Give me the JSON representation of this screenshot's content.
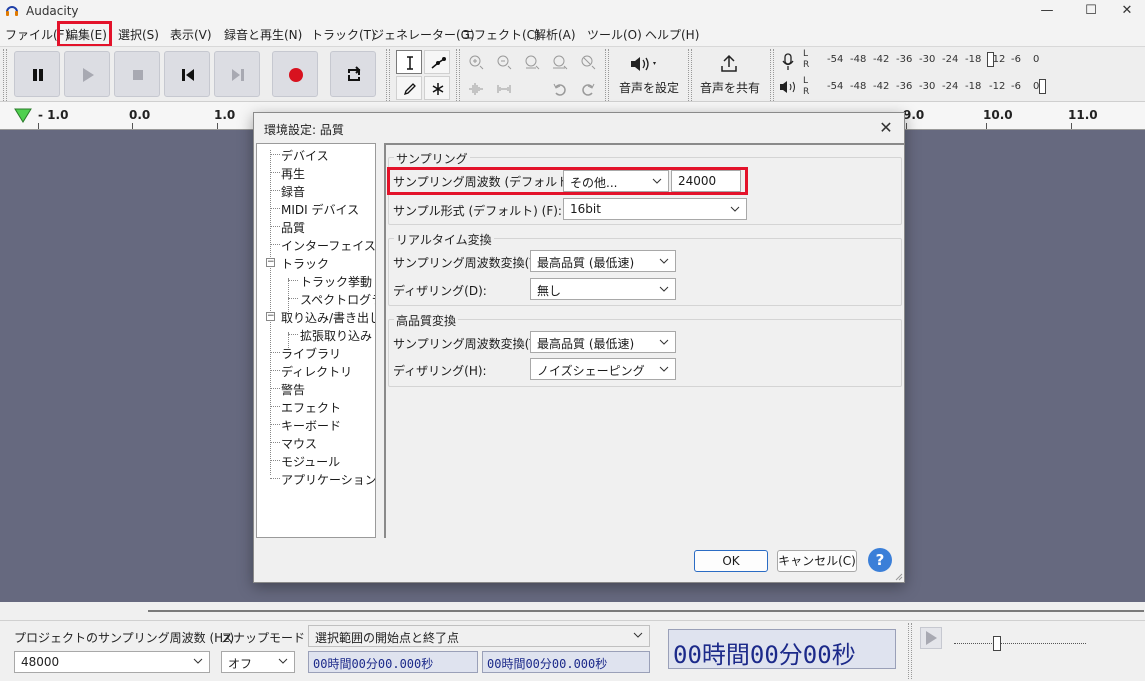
{
  "window": {
    "title": "Audacity",
    "minimize": "—",
    "maximize": "☐",
    "close": "✕"
  },
  "menu": [
    {
      "label": "ファイル(F)"
    },
    {
      "label": "編集(E)"
    },
    {
      "label": "選択(S)"
    },
    {
      "label": "表示(V)"
    },
    {
      "label": "録音と再生(N)"
    },
    {
      "label": "トラック(T)"
    },
    {
      "label": "ジェネレーター(G)"
    },
    {
      "label": "エフェクト(C)"
    },
    {
      "label": "解析(A)"
    },
    {
      "label": "ツール(O)"
    },
    {
      "label": "ヘルプ(H)"
    }
  ],
  "toolbar": {
    "audio_setup_label": "音声を設定",
    "share_label": "音声を共有",
    "meter_rec_channels": [
      "L",
      "R"
    ],
    "meter_play_channels": [
      "L",
      "R"
    ],
    "meter_ticks": [
      "-54",
      "-48",
      "-42",
      "-36",
      "-30",
      "-24",
      "-18",
      "-12",
      "-6",
      "0"
    ]
  },
  "ruler": {
    "labels": [
      "- 1.0",
      "0.0",
      "1.0",
      "9.0",
      "10.0",
      "11.0"
    ]
  },
  "dialog": {
    "title": "環境設定: 品質",
    "close": "✕",
    "tree": [
      "デバイス",
      "再生",
      "録音",
      "MIDI デバイス",
      "品質",
      "インターフェイス",
      "トラック",
      "トラック挙動",
      "スペクトログラム",
      "取り込み/書き出し",
      "拡張取り込み",
      "ライブラリ",
      "ディレクトリ",
      "警告",
      "エフェクト",
      "キーボード",
      "マウス",
      "モジュール",
      "アプリケーション"
    ],
    "tree_expander": "−",
    "sampling": {
      "group_title": "サンプリング",
      "rate_label": "サンプリング周波数 (デフォルト) (R):",
      "rate_value": "その他...",
      "rate_custom": "24000",
      "format_label": "サンプル形式 (デフォルト) (F):",
      "format_value": "16bit"
    },
    "realtime": {
      "group_title": "リアルタイム変換",
      "converter_label": "サンプリング周波数変換(V):",
      "converter_value": "最高品質 (最低速)",
      "dither_label": "ディザリング(D):",
      "dither_value": "無し"
    },
    "hq": {
      "group_title": "高品質変換",
      "converter_label": "サンプリング周波数変換(T):",
      "converter_value": "最高品質 (最低速)",
      "dither_label": "ディザリング(H):",
      "dither_value": "ノイズシェーピング"
    },
    "ok": "OK",
    "cancel": "キャンセル(C)",
    "help": "?"
  },
  "selection_bar": {
    "project_rate_label": "プロジェクトのサンプリング周波数 (Hz)",
    "project_rate_value": "48000",
    "snap_label": "スナップモード",
    "snap_value": "オフ",
    "selection_mode": "選択範囲の開始点と終了点",
    "start_time": "00時間00分00.000秒",
    "end_time": "00時間00分00.000秒",
    "big_time": "00時間00分00秒"
  },
  "colors": {
    "accent_red": "#e3122a",
    "track_bg": "#66697f",
    "time_text": "#1c2a8a"
  }
}
